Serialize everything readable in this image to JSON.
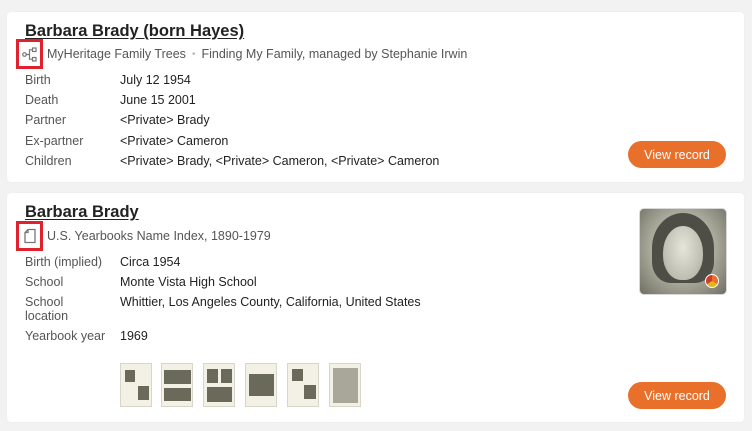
{
  "records": [
    {
      "title": "Barbara Brady (born Hayes)",
      "source_icon": "family-tree-icon",
      "source_name": "MyHeritage Family Trees",
      "source_separator": "•",
      "source_detail": "Finding My Family, managed by Stephanie Irwin",
      "fields": [
        {
          "label": "Birth",
          "value": "July 12 1954"
        },
        {
          "label": "Death",
          "value": "June 15 2001"
        },
        {
          "label": "Partner",
          "value": "<Private> Brady"
        },
        {
          "label": "Ex-partner",
          "value": "<Private> Cameron"
        },
        {
          "label": "Children",
          "value": "<Private> Brady, <Private> Cameron, <Private> Cameron"
        }
      ],
      "button_label": "View record"
    },
    {
      "title": "Barbara Brady",
      "source_icon": "document-icon",
      "source_name": "U.S. Yearbooks Name Index, 1890-1979",
      "fields": [
        {
          "label": "Birth (implied)",
          "value": "Circa 1954"
        },
        {
          "label": "School",
          "value": "Monte Vista High School"
        },
        {
          "label": "School\nlocation",
          "value": "Whittier, Los Angeles County, California, United States"
        },
        {
          "label": "Yearbook year",
          "value": "1969"
        }
      ],
      "thumbnail_count": 6,
      "button_label": "View record"
    }
  ],
  "colors": {
    "button": "#e8702a",
    "highlight_box": "#e0212e",
    "background": "#f2f2f2"
  }
}
